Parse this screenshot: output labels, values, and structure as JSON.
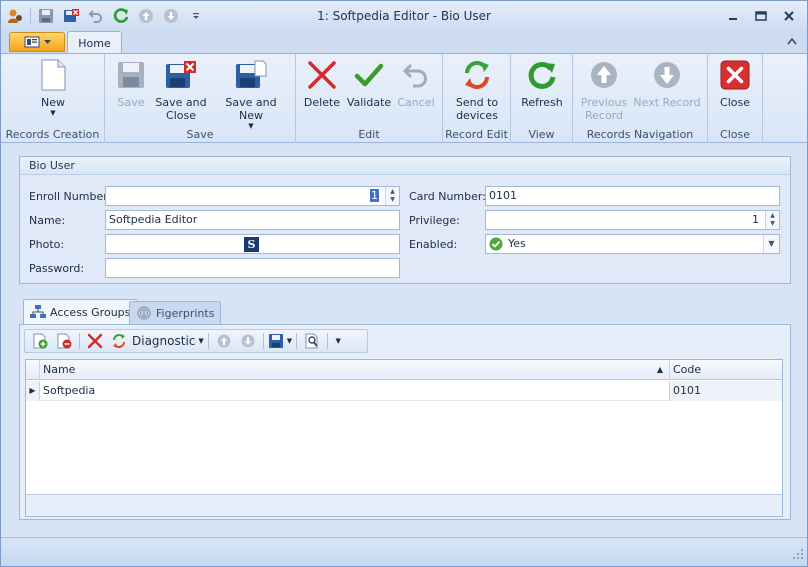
{
  "window": {
    "title": "1: Softpedia Editor - Bio User"
  },
  "tabs": {
    "home": "Home"
  },
  "ribbon": {
    "groups": {
      "records_creation": "Records Creation",
      "save": "Save",
      "edit": "Edit",
      "record_edit": "Record Edit",
      "view": "View",
      "records_navigation": "Records Navigation",
      "close": "Close"
    },
    "buttons": {
      "new": "New",
      "save": "Save",
      "save_and_close_1": "Save and",
      "save_and_close_2": "Close",
      "save_and_new": "Save and New",
      "delete": "Delete",
      "validate": "Validate",
      "cancel": "Cancel",
      "send_to_1": "Send to",
      "send_to_2": "devices",
      "refresh": "Refresh",
      "previous_1": "Previous",
      "previous_2": "Record",
      "next_record": "Next Record",
      "close": "Close"
    }
  },
  "form": {
    "section_title": "Bio User",
    "enroll_label": "Enroll Number:",
    "enroll_value": "1",
    "name_label": "Name:",
    "name_value": "Softpedia Editor",
    "photo_label": "Photo:",
    "photo_glyph": "S",
    "password_label": "Password:",
    "card_label": "Card Number:",
    "card_value": "0101",
    "privilege_label": "Privilege:",
    "privilege_value": "1",
    "enabled_label": "Enabled:",
    "enabled_value": "Yes"
  },
  "detail_tabs": {
    "access_groups": "Access Groups",
    "fingerprints": "Figerprints"
  },
  "toolbar": {
    "diagnostic": "Diagnostic"
  },
  "grid": {
    "columns": [
      "Name",
      "Code"
    ],
    "rows": [
      {
        "name": "Softpedia",
        "code": "0101"
      }
    ]
  },
  "colors": {
    "accent": "#3a75c9",
    "app_button": "#f6a31a",
    "delete_red": "#d42a2a",
    "validate_green": "#3a9a2a"
  }
}
